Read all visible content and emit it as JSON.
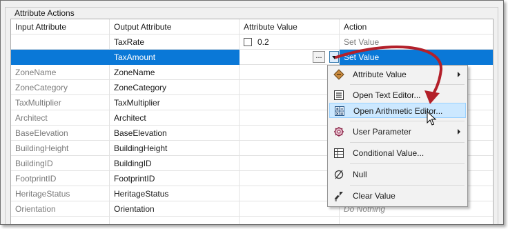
{
  "panel": {
    "title": "Attribute Actions"
  },
  "table": {
    "headers": [
      "Input Attribute",
      "Output Attribute",
      "Attribute Value",
      "Action"
    ],
    "rows": [
      {
        "input": "",
        "output": "TaxRate",
        "value": "0.2",
        "action": "Set Value"
      },
      {
        "input": "",
        "output": "TaxAmount",
        "value": "",
        "action": "Set Value"
      },
      {
        "input": "ZoneName",
        "output": "ZoneName",
        "value": "",
        "action": ""
      },
      {
        "input": "ZoneCategory",
        "output": "ZoneCategory",
        "value": "",
        "action": ""
      },
      {
        "input": "TaxMultiplier",
        "output": "TaxMultiplier",
        "value": "",
        "action": ""
      },
      {
        "input": "Architect",
        "output": "Architect",
        "value": "",
        "action": ""
      },
      {
        "input": "BaseElevation",
        "output": "BaseElevation",
        "value": "",
        "action": ""
      },
      {
        "input": "BuildingHeight",
        "output": "BuildingHeight",
        "value": "",
        "action": ""
      },
      {
        "input": "BuildingID",
        "output": "BuildingID",
        "value": "",
        "action": ""
      },
      {
        "input": "FootprintID",
        "output": "FootprintID",
        "value": "",
        "action": ""
      },
      {
        "input": "HeritageStatus",
        "output": "HeritageStatus",
        "value": "",
        "action": ""
      },
      {
        "input": "Orientation",
        "output": "Orientation",
        "value": "",
        "action": "Do Nothing"
      }
    ],
    "ellipsis_label": "..."
  },
  "menu": {
    "items": [
      {
        "label": "Attribute Value",
        "icon": "attribute-value-icon",
        "submenu": true
      },
      {
        "label": "Open Text Editor...",
        "icon": "text-editor-icon",
        "submenu": false
      },
      {
        "label": "Open Arithmetic Editor...",
        "icon": "arithmetic-editor-icon",
        "submenu": false,
        "highlighted": true
      },
      {
        "label": "User Parameter",
        "icon": "user-parameter-icon",
        "submenu": true
      },
      {
        "label": "Conditional Value...",
        "icon": "conditional-value-icon",
        "submenu": false
      },
      {
        "label": "Null",
        "icon": "null-icon",
        "submenu": false
      },
      {
        "label": "Clear Value",
        "icon": "clear-value-icon",
        "submenu": false
      }
    ]
  },
  "colors": {
    "selection": "#0a78d7",
    "highlight": "#cce8ff",
    "annotation_arrow": "#b3202a"
  }
}
